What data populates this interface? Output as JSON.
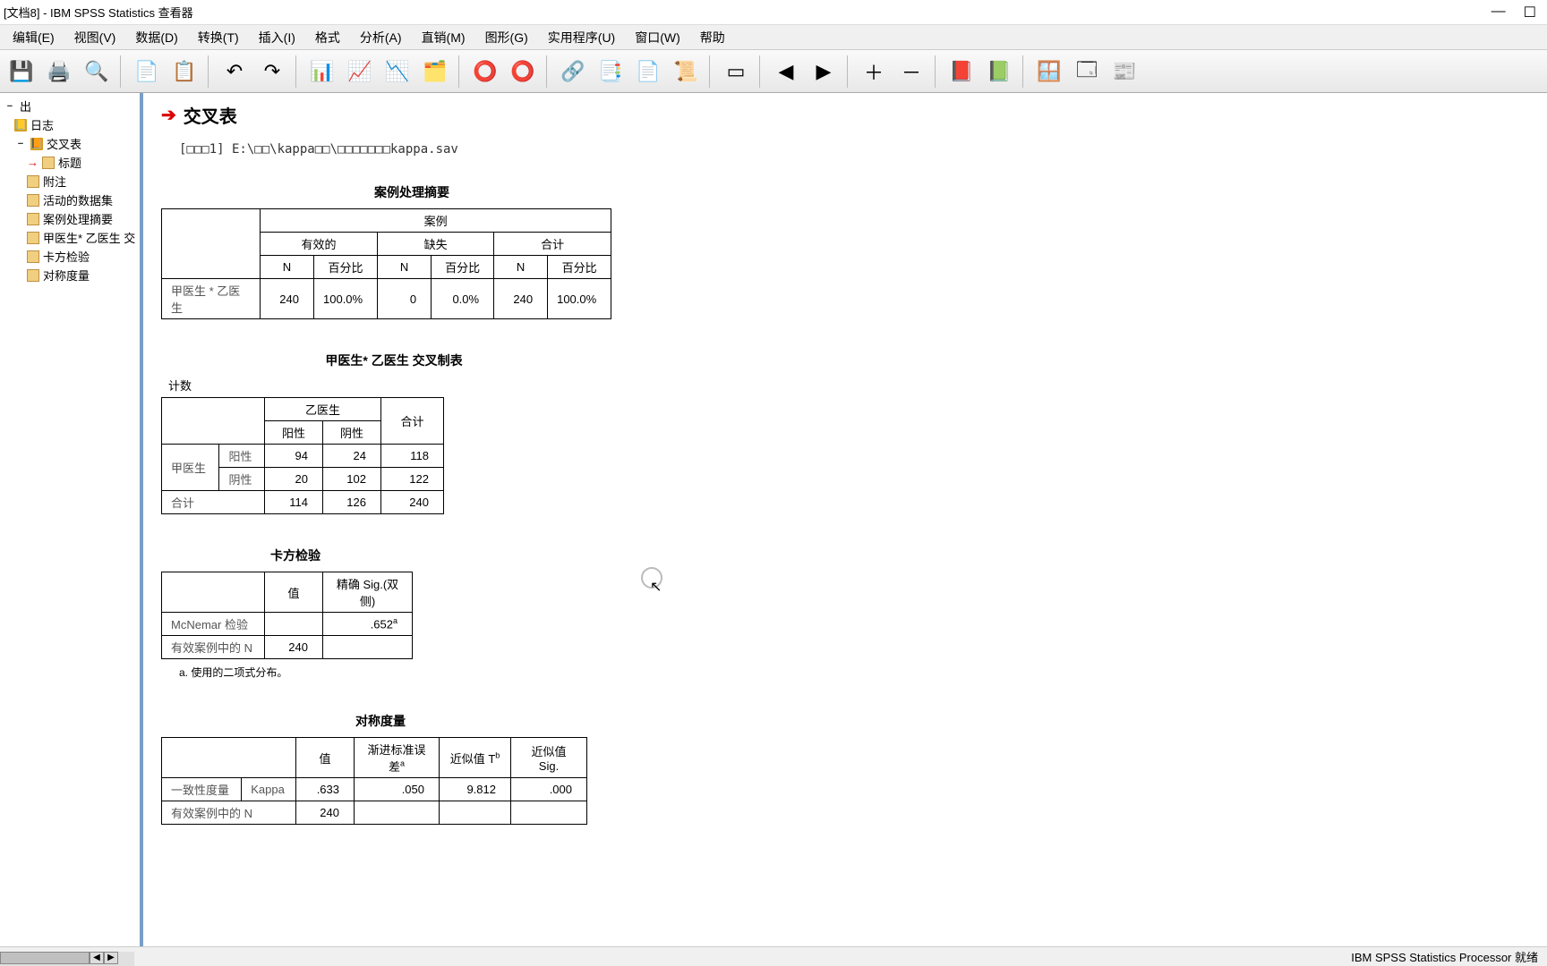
{
  "titlebar": {
    "text": "[文档8] - IBM SPSS Statistics 查看器",
    "minimize": "—",
    "maximize": "☐"
  },
  "menu": [
    "编辑(E)",
    "视图(V)",
    "数据(D)",
    "转换(T)",
    "插入(I)",
    "格式",
    "分析(A)",
    "直销(M)",
    "图形(G)",
    "实用程序(U)",
    "窗口(W)",
    "帮助"
  ],
  "nav": {
    "root": "出",
    "items": [
      "日志",
      "交叉表",
      "标题",
      "附注",
      "活动的数据集",
      "案例处理摘要",
      "甲医生* 乙医生 交",
      "卡方检验",
      "对称度量"
    ]
  },
  "output": {
    "title": "交叉表",
    "syntax": "[□□□1] E:\\□□\\kappa□□\\□□□□□□□kappa.sav"
  },
  "case_summary": {
    "title": "案例处理摘要",
    "h_cases": "案例",
    "h_valid": "有效的",
    "h_missing": "缺失",
    "h_total": "合计",
    "h_n": "N",
    "h_pct": "百分比",
    "row_lbl": "甲医生 * 乙医生",
    "valid_n": "240",
    "valid_pct": "100.0%",
    "miss_n": "0",
    "miss_pct": "0.0%",
    "tot_n": "240",
    "tot_pct": "100.0%"
  },
  "crosstab": {
    "title": "甲医生* 乙医生 交叉制表",
    "sub": "计数",
    "h_col": "乙医生",
    "h_pos": "阳性",
    "h_neg": "阴性",
    "h_total": "合计",
    "r_lbl": "甲医生",
    "r1": "阳性",
    "c11": "94",
    "c12": "24",
    "c1t": "118",
    "r2": "阴性",
    "c21": "20",
    "c22": "102",
    "c2t": "122",
    "rt": "合计",
    "ct1": "114",
    "ct2": "126",
    "ctt": "240"
  },
  "chisq": {
    "title": "卡方检验",
    "h_val": "值",
    "h_sig": "精确 Sig.(双侧)",
    "r1": "McNemar 检验",
    "sig1": ".652",
    "r2": "有效案例中的 N",
    "v2": "240",
    "foot": "a. 使用的二项式分布。"
  },
  "symm": {
    "title": "对称度量",
    "h_val": "值",
    "h_se": "渐进标准误差",
    "h_t": "近似值 T",
    "h_sig": "近似值 Sig.",
    "r1a": "一致性度量",
    "r1b": "Kappa",
    "v1": ".633",
    "se1": ".050",
    "t1": "9.812",
    "sig1": ".000",
    "r2": "有效案例中的 N",
    "v2": "240"
  },
  "status": "IBM SPSS Statistics Processor 就绪",
  "chart_data": {
    "type": "table",
    "tables": [
      {
        "name": "案例处理摘要",
        "columns": [
          "",
          "有效的 N",
          "有效的 百分比",
          "缺失 N",
          "缺失 百分比",
          "合计 N",
          "合计 百分比"
        ],
        "rows": [
          [
            "甲医生 * 乙医生",
            240,
            "100.0%",
            0,
            "0.0%",
            240,
            "100.0%"
          ]
        ]
      },
      {
        "name": "甲医生* 乙医生 交叉制表 (计数)",
        "columns": [
          "",
          "乙医生 阳性",
          "乙医生 阴性",
          "合计"
        ],
        "rows": [
          [
            "甲医生 阳性",
            94,
            24,
            118
          ],
          [
            "甲医生 阴性",
            20,
            102,
            122
          ],
          [
            "合计",
            114,
            126,
            240
          ]
        ]
      },
      {
        "name": "卡方检验",
        "columns": [
          "",
          "值",
          "精确 Sig.(双侧)"
        ],
        "rows": [
          [
            "McNemar 检验",
            null,
            0.652
          ],
          [
            "有效案例中的 N",
            240,
            null
          ]
        ],
        "footnote": "a. 使用的二项式分布。"
      },
      {
        "name": "对称度量",
        "columns": [
          "",
          "值",
          "渐进标准误差 a",
          "近似值 T b",
          "近似值 Sig."
        ],
        "rows": [
          [
            "一致性度量 Kappa",
            0.633,
            0.05,
            9.812,
            0.0
          ],
          [
            "有效案例中的 N",
            240,
            null,
            null,
            null
          ]
        ]
      }
    ]
  }
}
